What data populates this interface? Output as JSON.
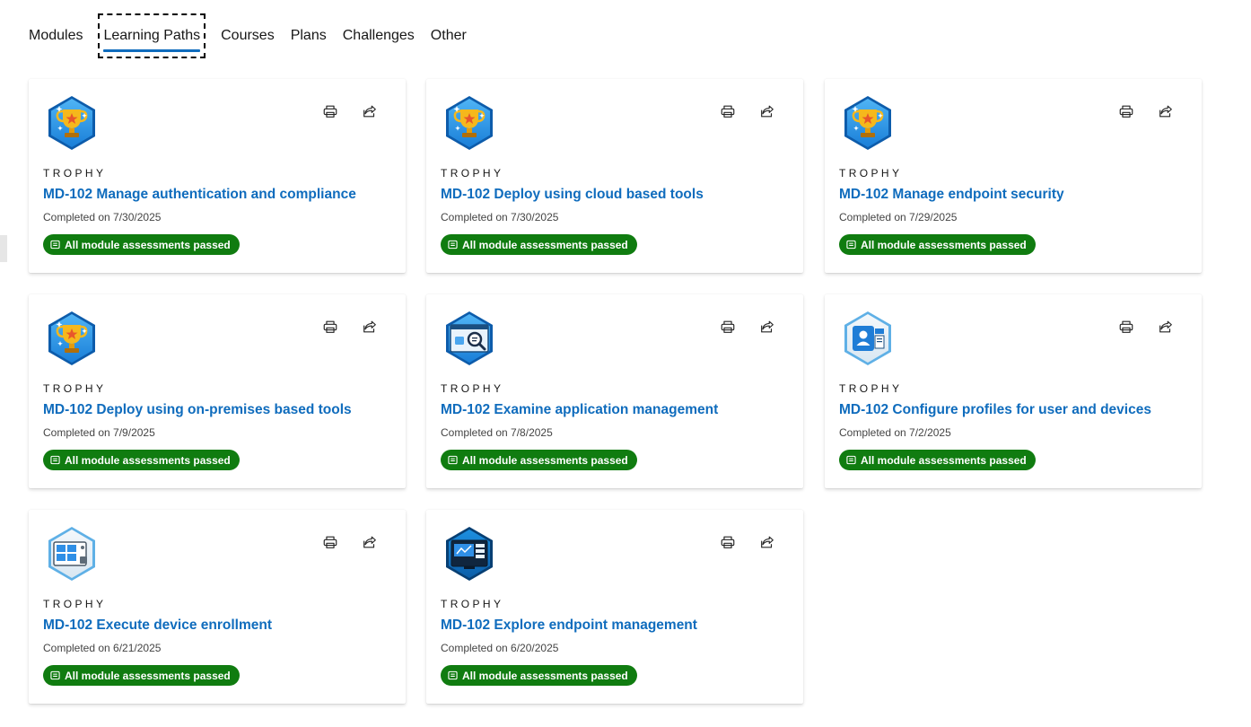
{
  "tabs": [
    {
      "label": "Modules"
    },
    {
      "label": "Learning Paths"
    },
    {
      "label": "Courses"
    },
    {
      "label": "Plans"
    },
    {
      "label": "Challenges"
    },
    {
      "label": "Other"
    }
  ],
  "active_tab": "Learning Paths",
  "colors": {
    "link": "#0f6cbd",
    "success": "#107c10"
  },
  "cards": [
    {
      "eyebrow": "TROPHY",
      "title": "MD-102 Manage authentication and compliance",
      "completed": "Completed on 7/30/2025",
      "status": "All module assessments passed",
      "icon": "trophy-icon"
    },
    {
      "eyebrow": "TROPHY",
      "title": "MD-102 Deploy using cloud based tools",
      "completed": "Completed on 7/30/2025",
      "status": "All module assessments passed",
      "icon": "trophy-icon"
    },
    {
      "eyebrow": "TROPHY",
      "title": "MD-102 Manage endpoint security",
      "completed": "Completed on 7/29/2025",
      "status": "All module assessments passed",
      "icon": "trophy-icon"
    },
    {
      "eyebrow": "TROPHY",
      "title": "MD-102 Deploy using on-premises based tools",
      "completed": "Completed on 7/9/2025",
      "status": "All module assessments passed",
      "icon": "trophy-icon"
    },
    {
      "eyebrow": "TROPHY",
      "title": "MD-102 Examine application management",
      "completed": "Completed on 7/8/2025",
      "status": "All module assessments passed",
      "icon": "app-search-icon"
    },
    {
      "eyebrow": "TROPHY",
      "title": "MD-102 Configure profiles for user and devices",
      "completed": "Completed on 7/2/2025",
      "status": "All module assessments passed",
      "icon": "profile-card-icon"
    },
    {
      "eyebrow": "TROPHY",
      "title": "MD-102 Execute device enrollment",
      "completed": "Completed on 6/21/2025",
      "status": "All module assessments passed",
      "icon": "device-enrollment-icon"
    },
    {
      "eyebrow": "TROPHY",
      "title": "MD-102 Explore endpoint management",
      "completed": "Completed on 6/20/2025",
      "status": "All module assessments passed",
      "icon": "endpoint-dashboard-icon"
    }
  ]
}
